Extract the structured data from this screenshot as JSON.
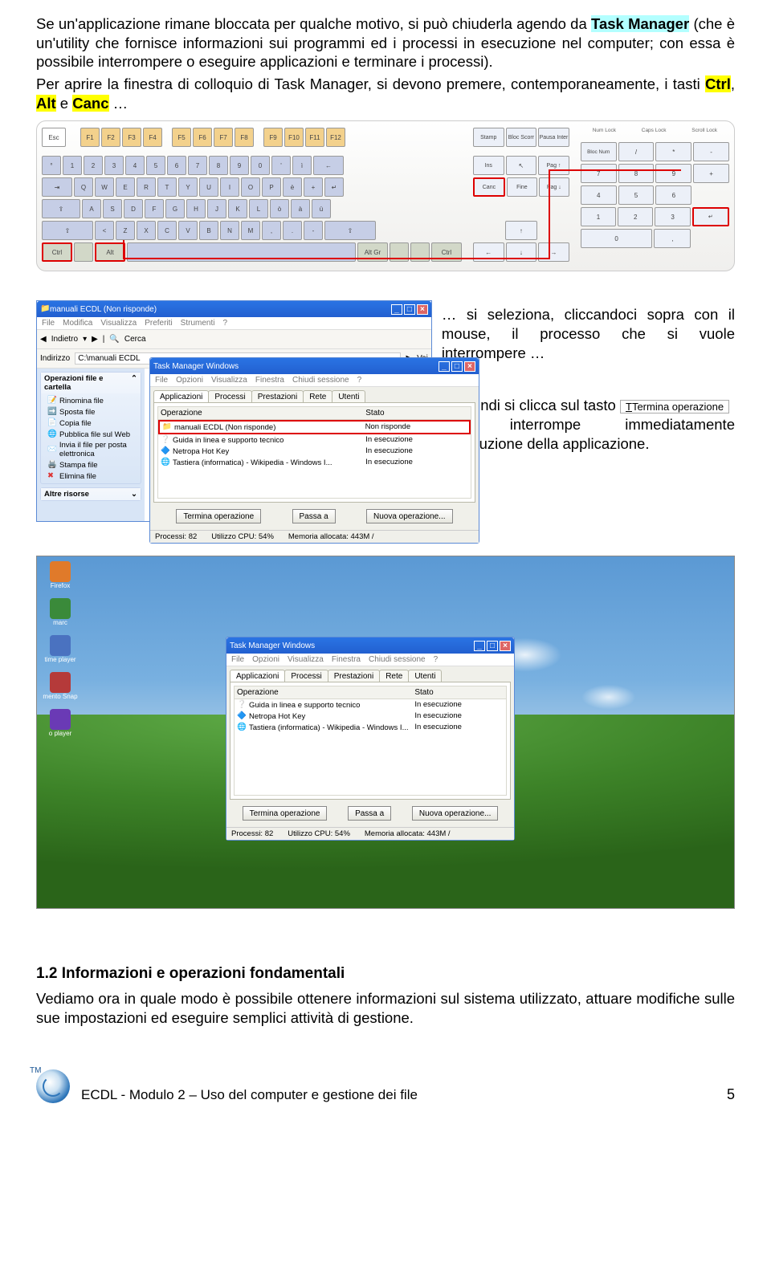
{
  "para1": {
    "t1": "Se un'applicazione rimane bloccata per qualche motivo, si può chiuderla agendo da ",
    "tm": "Task Manager",
    "t2": " (che è un'utility che fornisce informazioni sui programmi ed i processi in esecuzione nel computer; con essa è possibile interrompere o eseguire applicazioni e terminare i processi)."
  },
  "para2": {
    "t1": "Per aprire la finestra di colloquio di Task Manager, si devono premere, contemporaneamente, i tasti ",
    "k1": "Ctrl",
    "s1": ", ",
    "k2": "Alt",
    "s2": " e ",
    "k3": "Canc",
    "t2": " …"
  },
  "kb": {
    "esc": "Esc",
    "f": [
      "F1",
      "F2",
      "F3",
      "F4",
      "F5",
      "F6",
      "F7",
      "F8",
      "F9",
      "F10",
      "F11",
      "F12"
    ],
    "r1": [
      "°",
      "1",
      "2",
      "3",
      "4",
      "5",
      "6",
      "7",
      "8",
      "9",
      "0",
      "'",
      "ì",
      "←"
    ],
    "r2": [
      "⇥",
      "Q",
      "W",
      "E",
      "R",
      "T",
      "Y",
      "U",
      "I",
      "O",
      "P",
      "è",
      "+",
      "↵"
    ],
    "r3": [
      "⇪",
      "A",
      "S",
      "D",
      "F",
      "G",
      "H",
      "J",
      "K",
      "L",
      "ò",
      "à",
      "ù"
    ],
    "r4": [
      "⇧",
      "<",
      "Z",
      "X",
      "C",
      "V",
      "B",
      "N",
      "M",
      ",",
      ".",
      "-",
      "⇧"
    ],
    "r5": [
      "Ctrl",
      "",
      "Alt",
      "",
      "Alt Gr",
      "",
      "",
      "Ctrl"
    ],
    "ins": [
      "Stamp",
      "Bloc Scorr",
      "Pausa Inter"
    ],
    "nav": [
      "Ins",
      "↖",
      "Pag ↑"
    ],
    "nav2": [
      "Canc",
      "Fine",
      "Pag ↓"
    ],
    "arr": [
      "",
      "↑",
      "",
      "←",
      "↓",
      "→"
    ],
    "np": [
      "Bloc Num",
      "/",
      "*",
      "-",
      "7",
      "8",
      "9",
      "+",
      "4",
      "5",
      "6",
      "1",
      "2",
      "3",
      "↵",
      "0",
      ","
    ],
    "led": [
      "Num Lock",
      "Caps Lock",
      "Scroll Lock"
    ]
  },
  "side": {
    "p1": "… si seleziona, cliccandoci sopra con il mouse, il processo che si vuole interrompere …",
    "p2a": "… quindi si clicca sul tasto ",
    "p2btn": "Termina operazione",
    "p2b": "che interrompe immediatamente l'esecuzione della applicazione."
  },
  "explorer": {
    "title": "manuali ECDL (Non risponde)",
    "menu": [
      "File",
      "Modifica",
      "Visualizza",
      "Preferiti",
      "Strumenti",
      "?"
    ],
    "back": "Indietro",
    "search": "Cerca",
    "addrLbl": "Indirizzo",
    "addr": "C:\\manuali ECDL",
    "go": "Vai",
    "panel1": "Operazioni file e cartella",
    "ops": [
      "Rinomina file",
      "Sposta file",
      "Copia file",
      "Pubblica file sul Web",
      "Invia il file per posta elettronica",
      "Stampa file",
      "Elimina file"
    ],
    "panel2": "Altre risorse"
  },
  "tm": {
    "title": "Task Manager Windows",
    "menu": [
      "File",
      "Opzioni",
      "Visualizza",
      "Finestra",
      "Chiudi sessione",
      "?"
    ],
    "tabs": [
      "Applicazioni",
      "Processi",
      "Prestazioni",
      "Rete",
      "Utenti"
    ],
    "h1": "Operazione",
    "h2": "Stato",
    "rows": [
      {
        "name": "manuali ECDL (Non risponde)",
        "state": "Non risponde"
      },
      {
        "name": "Guida in linea e supporto tecnico",
        "state": "In esecuzione"
      },
      {
        "name": "Netropa Hot Key",
        "state": "In esecuzione"
      },
      {
        "name": "Tastiera (informatica) - Wikipedia - Windows I...",
        "state": "In esecuzione"
      }
    ],
    "b1": "Termina operazione",
    "b2": "Passa a",
    "b3": "Nuova operazione...",
    "s1": "Processi: 82",
    "s2": "Utilizzo CPU: 54%",
    "s3": "Memoria allocata: 443M /"
  },
  "tm2": {
    "rows": [
      {
        "name": "Guida in linea e supporto tecnico",
        "state": "In esecuzione"
      },
      {
        "name": "Netropa Hot Key",
        "state": "In esecuzione"
      },
      {
        "name": "Tastiera (informatica) - Wikipedia - Windows I...",
        "state": "In esecuzione"
      }
    ]
  },
  "desktopIcons": [
    {
      "label": "Firefox",
      "c": "#e07a2a"
    },
    {
      "label": "marc",
      "c": "#3a8a3a"
    },
    {
      "label": "time player",
      "c": "#4a72c0"
    },
    {
      "label": "mento Snap",
      "c": "#b53a3a"
    },
    {
      "label": "o player",
      "c": "#6a3ab5"
    }
  ],
  "section": "1.2    Informazioni e operazioni fondamentali",
  "sectionPara": "Vediamo ora in quale modo è possibile ottenere informazioni sul sistema utilizzato, attuare modifiche sulle sue impostazioni ed eseguire semplici attività di gestione.",
  "footer": "ECDL - Modulo 2 – Uso del computer e gestione dei file",
  "page": "5"
}
